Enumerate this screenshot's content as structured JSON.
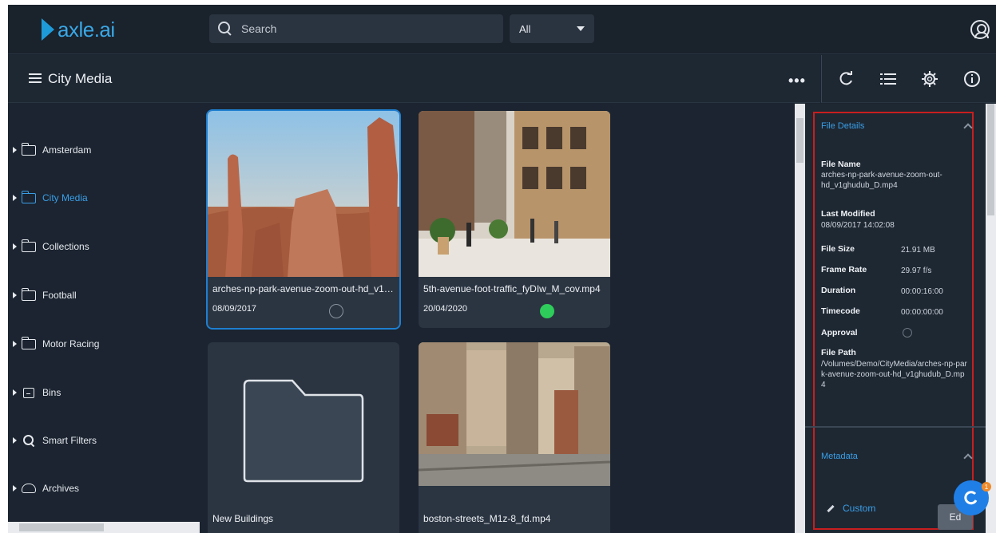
{
  "app": {
    "logo_text": "axle.ai",
    "brand_color": "#1f9ad8",
    "accent_color": "#3a9ee6"
  },
  "search": {
    "placeholder": "Search",
    "scope": "All"
  },
  "header": {
    "breadcrumb": "City Media",
    "more_label": "•••",
    "tools": [
      "refresh-icon",
      "list-icon",
      "gear-icon",
      "info-icon"
    ]
  },
  "sidebar": {
    "items": [
      {
        "label": "Amsterdam",
        "icon": "folder-icon"
      },
      {
        "label": "City Media",
        "icon": "folder-icon",
        "active": true
      },
      {
        "label": "Collections",
        "icon": "folder-icon"
      },
      {
        "label": "Football",
        "icon": "folder-icon"
      },
      {
        "label": "Motor Racing",
        "icon": "folder-icon"
      },
      {
        "label": "Bins",
        "icon": "bins-icon"
      },
      {
        "label": "Smart Filters",
        "icon": "search-icon"
      },
      {
        "label": "Archives",
        "icon": "cloud-icon"
      }
    ]
  },
  "assets": [
    {
      "title": "arches-np-park-avenue-zoom-out-hd_v1ghudub_D.mp4",
      "date": "08/09/2017",
      "approval": "none",
      "selected": true
    },
    {
      "title": "5th-avenue-foot-traffic_fyDIw_M_cov.mp4",
      "date": "20/04/2020",
      "approval": "approved"
    },
    {
      "title": "New Buildings",
      "date": "",
      "type": "folder"
    },
    {
      "title": "boston-streets_M1z-8_fd.mp4",
      "date": ""
    }
  ],
  "details": {
    "section_title": "File Details",
    "file_name_label": "File Name",
    "file_name": "arches-np-park-avenue-zoom-out-hd_v1ghudub_D.mp4",
    "last_modified_label": "Last Modified",
    "last_modified": "08/09/2017 14:02:08",
    "file_size_label": "File Size",
    "file_size": "21.91 MB",
    "frame_rate_label": "Frame Rate",
    "frame_rate": "29.97 f/s",
    "duration_label": "Duration",
    "duration": "00:00:16:00",
    "timecode_label": "Timecode",
    "timecode": "00:00:00:00",
    "approval_label": "Approval",
    "file_path_label": "File Path",
    "file_path": "/Volumes/Demo/CityMedia/arches-np-park-avenue-zoom-out-hd_v1ghudub_D.mp4",
    "metadata_title": "Metadata",
    "custom_label": "Custom",
    "edit_label": "Ed",
    "badge_count": "1"
  }
}
